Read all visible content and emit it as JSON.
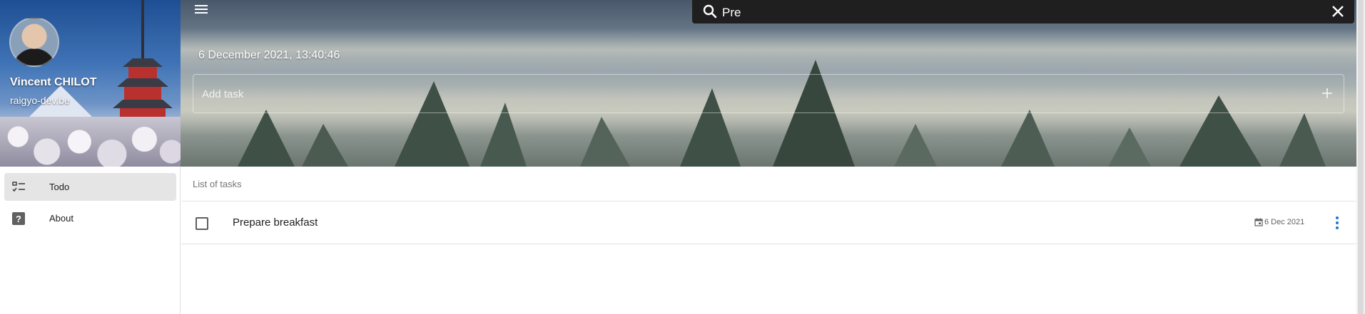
{
  "sidebar": {
    "user": {
      "name": "Vincent CHILOT",
      "site": "raigyo-dev.be"
    },
    "nav": [
      {
        "label": "Todo",
        "icon": "checklist-icon",
        "active": true
      },
      {
        "label": "About",
        "icon": "help-icon",
        "active": false
      }
    ]
  },
  "header": {
    "datetime": "6 December 2021, 13:40:46",
    "add_task_placeholder": "Add task"
  },
  "search": {
    "value": "Pre"
  },
  "main": {
    "list_title": "List of tasks",
    "tasks": [
      {
        "title": "Prepare breakfast",
        "date": "6 Dec 2021",
        "done": false
      }
    ]
  },
  "colors": {
    "accent": "#1976d2",
    "search_bg": "#1f1f1f",
    "active_nav": "#e5e5e5"
  }
}
